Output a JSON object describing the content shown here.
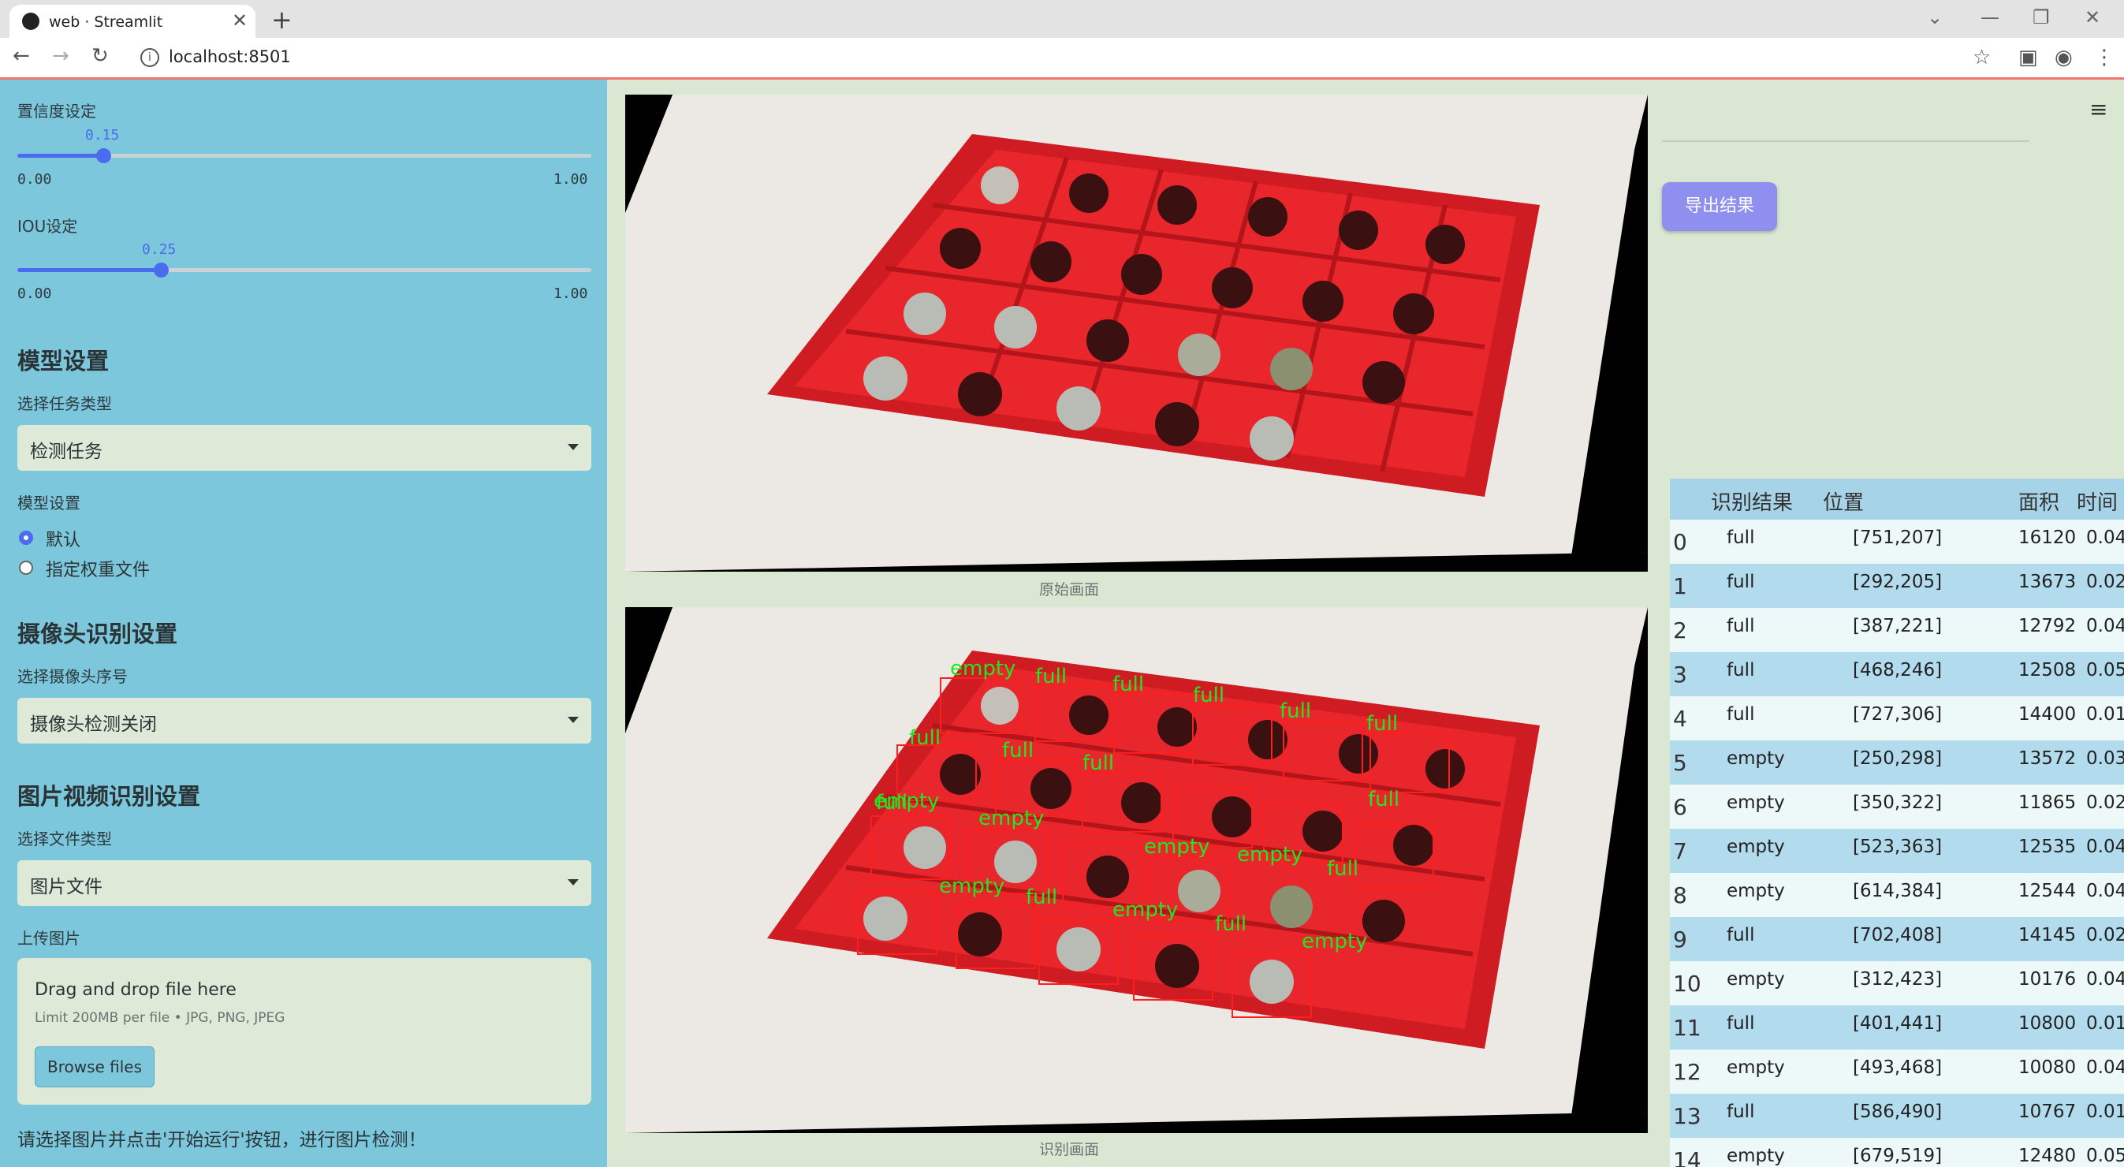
{
  "browser": {
    "tab_title": "web · Streamlit",
    "url": "localhost:8501"
  },
  "sidebar": {
    "confidence": {
      "label": "置信度设定",
      "value": "0.15",
      "min": "0.00",
      "max": "1.00",
      "fraction": 0.15
    },
    "iou": {
      "label": "IOU设定",
      "value": "0.25",
      "min": "0.00",
      "max": "1.00",
      "fraction": 0.25
    },
    "model_section": "模型设置",
    "task_label": "选择任务类型",
    "task_value": "检测任务",
    "model_label": "模型设置",
    "model_options": [
      "默认",
      "指定权重文件"
    ],
    "camera_section": "摄像头识别设置",
    "camera_label": "选择摄像头序号",
    "camera_value": "摄像头检测关闭",
    "media_section": "图片视频识别设置",
    "file_type_label": "选择文件类型",
    "file_type_value": "图片文件",
    "upload_label": "上传图片",
    "upload": {
      "title": "Drag and drop file here",
      "limit": "Limit 200MB per file • JPG, PNG, JPEG",
      "button": "Browse files"
    },
    "hint": "请选择图片并点击'开始运行'按钮，进行图片检测！"
  },
  "main": {
    "original_caption": "原始画面",
    "result_caption": "识别画面",
    "detections": [
      "empty",
      "full",
      "full",
      "full",
      "full",
      "full",
      "full",
      "full",
      "full",
      "full",
      "full",
      "empty",
      "empty",
      "empty",
      "empty",
      "full",
      "empty",
      "full",
      "empty",
      "full",
      "empty"
    ]
  },
  "right": {
    "export_button": "导出结果",
    "table": {
      "headers": [
        "识别结果",
        "位置",
        "面积",
        "时间"
      ],
      "rows": [
        [
          "0",
          "full",
          "[751,207]",
          "16120",
          "0.04"
        ],
        [
          "1",
          "full",
          "[292,205]",
          "13673",
          "0.02"
        ],
        [
          "2",
          "full",
          "[387,221]",
          "12792",
          "0.04"
        ],
        [
          "3",
          "full",
          "[468,246]",
          "12508",
          "0.05"
        ],
        [
          "4",
          "full",
          "[727,306]",
          "14400",
          "0.01"
        ],
        [
          "5",
          "empty",
          "[250,298]",
          "13572",
          "0.03"
        ],
        [
          "6",
          "empty",
          "[350,322]",
          "11865",
          "0.02"
        ],
        [
          "7",
          "empty",
          "[523,363]",
          "12535",
          "0.04"
        ],
        [
          "8",
          "empty",
          "[614,384]",
          "12544",
          "0.04"
        ],
        [
          "9",
          "full",
          "[702,408]",
          "14145",
          "0.02"
        ],
        [
          "10",
          "empty",
          "[312,423]",
          "10176",
          "0.04"
        ],
        [
          "11",
          "full",
          "[401,441]",
          "10800",
          "0.01"
        ],
        [
          "12",
          "empty",
          "[493,468]",
          "10080",
          "0.04"
        ],
        [
          "13",
          "full",
          "[586,490]",
          "10767",
          "0.01"
        ],
        [
          "14",
          "empty",
          "[679,519]",
          "12480",
          "0.05"
        ]
      ]
    }
  },
  "colors": {
    "sidebar_bg": "#7cc7db",
    "main_bg": "#d9e7d3",
    "accent": "#4a6cf0",
    "export_button": "#8f8ff0",
    "crate_red": "#e8262b",
    "label_green": "#22e622",
    "box_red": "#ff1e1e"
  }
}
